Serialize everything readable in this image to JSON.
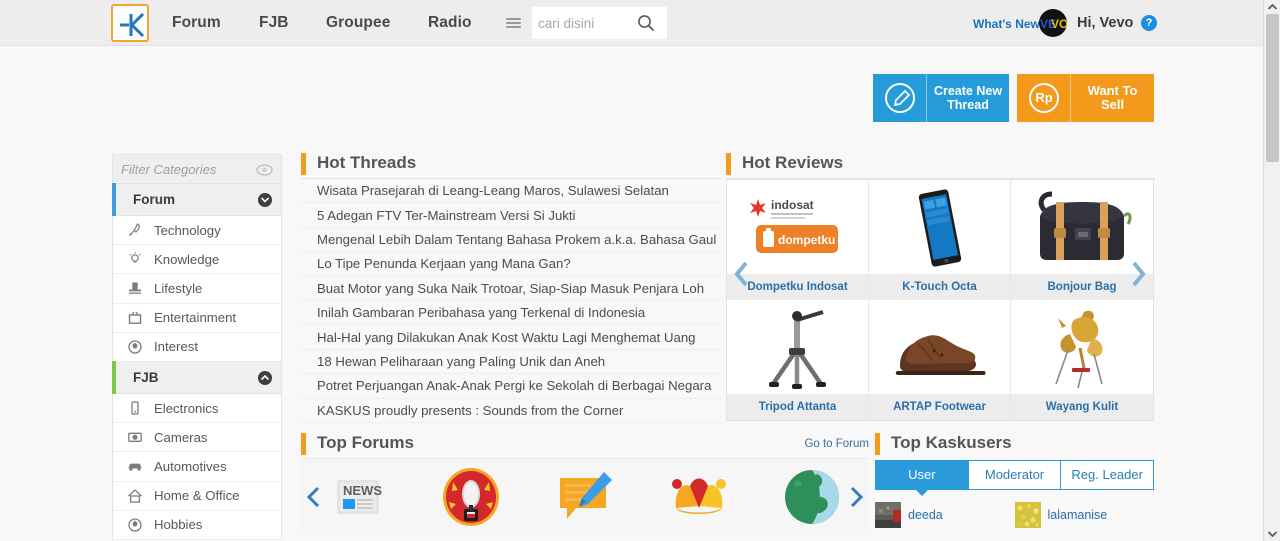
{
  "colors": {
    "brand_blue": "#259bd9",
    "brand_orange": "#f3991b",
    "accent_orange": "#f0a830",
    "header_bg": "#ededed",
    "page_bg": "#f8f8f8",
    "link_blue": "#2b6fa8",
    "forum_bar": "#3b9ee0",
    "fjb_bar": "#7ac943"
  },
  "header": {
    "logo_name": "kaskus-logo",
    "nav": [
      {
        "label": "Forum"
      },
      {
        "label": "FJB"
      },
      {
        "label": "Groupee"
      },
      {
        "label": "Radio"
      }
    ],
    "search": {
      "placeholder": "cari disini",
      "value": ""
    },
    "whats_new": "What's New?",
    "greeting": "Hi, Vevo",
    "avatar_left": "VE",
    "avatar_right": "VO",
    "help_glyph": "?"
  },
  "actions": {
    "create_thread": "Create New\nThread",
    "create_thread_line1": "Create New",
    "create_thread_line2": "Thread",
    "want_to_sell": "Want To Sell",
    "rp_glyph": "Rp"
  },
  "sidebar": {
    "filter_placeholder": "Filter Categories",
    "filter_value": "",
    "groups": [
      {
        "name": "Forum",
        "bar_color": "#3b9ee0",
        "state": "expanded",
        "chevron": "chevron-down-icon",
        "items": [
          {
            "label": "Technology",
            "icon": "rocket-icon"
          },
          {
            "label": "Knowledge",
            "icon": "lightbulb-icon"
          },
          {
            "label": "Lifestyle",
            "icon": "tophat-icon"
          },
          {
            "label": "Entertainment",
            "icon": "tv-icon"
          },
          {
            "label": "Interest",
            "icon": "soccer-icon"
          }
        ]
      },
      {
        "name": "FJB",
        "bar_color": "#7ac943",
        "state": "expanded",
        "chevron": "chevron-up-icon",
        "items": [
          {
            "label": "Electronics",
            "icon": "phone-icon"
          },
          {
            "label": "Cameras",
            "icon": "camera-icon"
          },
          {
            "label": "Automotives",
            "icon": "car-icon"
          },
          {
            "label": "Home & Office",
            "icon": "house-icon"
          },
          {
            "label": "Hobbies",
            "icon": "soccer-icon"
          }
        ]
      }
    ]
  },
  "hot_threads": {
    "title": "Hot Threads",
    "items": [
      "Wisata Prasejarah di Leang-Leang Maros, Sulawesi Selatan",
      "5 Adegan FTV Ter-Mainstream Versi Si Jukti",
      "Mengenal Lebih Dalam Tentang Bahasa Prokem a.k.a. Bahasa Gaul",
      "Lo Tipe Penunda Kerjaan yang Mana Gan?",
      "Buat Motor yang Suka Naik Trotoar, Siap-Siap Masuk Penjara Loh",
      "Inilah Gambaran Peribahasa yang Terkenal di Indonesia",
      "Hal-Hal yang Dilakukan Anak Kost Waktu Lagi Menghemat Uang",
      "18 Hewan Peliharaan yang Paling Unik dan Aneh",
      "Potret Perjuangan Anak-Anak Pergi ke Sekolah di Berbagai Negara",
      "KASKUS proudly presents : Sounds from the Corner"
    ]
  },
  "hot_reviews": {
    "title": "Hot Reviews",
    "prev_icon": "chevron-left-icon",
    "next_icon": "chevron-right-icon",
    "items": [
      {
        "caption": "Dompetku Indosat",
        "image": "indosat-dompetku-logo"
      },
      {
        "caption": "K-Touch Octa",
        "image": "tablet-photo"
      },
      {
        "caption": "Bonjour Bag",
        "image": "messenger-bag-photo"
      },
      {
        "caption": "Tripod Attanta",
        "image": "tripod-photo"
      },
      {
        "caption": "ARTAP Footwear",
        "image": "brown-shoes-photo"
      },
      {
        "caption": "Wayang Kulit",
        "image": "wayang-kulit-photo"
      }
    ]
  },
  "top_forums": {
    "title": "Top Forums",
    "go_to_forum": "Go to Forum",
    "prev_icon": "chevron-left-icon",
    "next_icon": "chevron-right-icon",
    "items": [
      {
        "icon": "news-paper-icon"
      },
      {
        "icon": "microphone-radio-icon"
      },
      {
        "icon": "speech-bubble-pencil-icon"
      },
      {
        "icon": "jester-hat-icon"
      },
      {
        "icon": "globe-icon"
      }
    ]
  },
  "top_kaskusers": {
    "title": "Top Kaskusers",
    "tabs": [
      {
        "label": "User",
        "active": true
      },
      {
        "label": "Moderator",
        "active": false
      },
      {
        "label": "Reg. Leader",
        "active": false
      }
    ],
    "users": [
      {
        "name": "deeda"
      },
      {
        "name": "lalamanise"
      }
    ]
  },
  "scrollbar": {
    "up_icon": "caret-up-icon",
    "down_icon": "caret-down-icon"
  }
}
